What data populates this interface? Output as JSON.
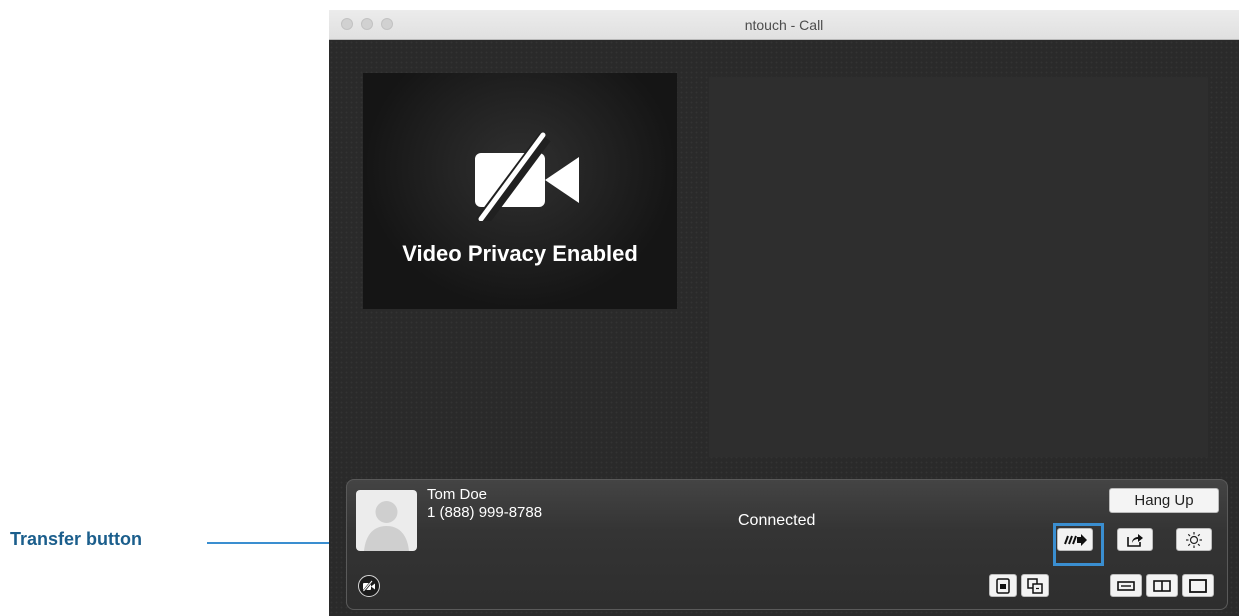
{
  "window": {
    "title": "ntouch - Call"
  },
  "video": {
    "privacy_text": "Video Privacy Enabled"
  },
  "call": {
    "contact_name": "Tom Doe",
    "contact_number": "1 (888) 999-8788",
    "status": "Connected",
    "hang_up_label": "Hang Up"
  },
  "annotation": {
    "label": "Transfer button"
  },
  "icons": {
    "camera_off": "video-camera-off-icon",
    "transfer": "transfer-icon",
    "share": "share-icon",
    "brightness": "brightness-icon",
    "privacy_toggle": "video-privacy-toggle-icon",
    "self_view": "self-view-icon",
    "pip": "picture-in-picture-icon",
    "layout_small": "layout-small-icon",
    "layout_split": "layout-split-icon",
    "layout_full": "layout-full-icon"
  },
  "colors": {
    "annotation": "#3a8ed0",
    "annotation_text": "#1b5e8c",
    "window_background": "#282828"
  }
}
